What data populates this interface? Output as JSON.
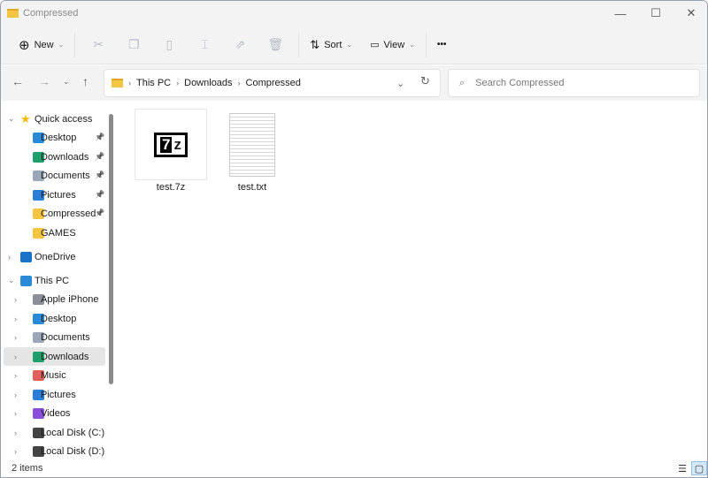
{
  "window": {
    "title": "Compressed"
  },
  "toolbar": {
    "new": "New",
    "sort": "Sort",
    "view": "View",
    "more": "•••"
  },
  "address": {
    "crumbs": [
      "This PC",
      "Downloads",
      "Compressed"
    ],
    "search_placeholder": "Search Compressed"
  },
  "sidebar": {
    "items": [
      {
        "label": "Quick access",
        "icon": "star-icon",
        "color": "#f5b800",
        "level": 0,
        "exp": "v",
        "pin": false
      },
      {
        "label": "Desktop",
        "icon": "desktop-icon",
        "color": "#2b8ad8",
        "level": 1,
        "exp": "",
        "pin": true
      },
      {
        "label": "Downloads",
        "icon": "download-icon",
        "color": "#1e9e6a",
        "level": 1,
        "exp": "",
        "pin": true
      },
      {
        "label": "Documents",
        "icon": "documents-icon",
        "color": "#9aa7b8",
        "level": 1,
        "exp": "",
        "pin": true
      },
      {
        "label": "Pictures",
        "icon": "pictures-icon",
        "color": "#2a7ed8",
        "level": 1,
        "exp": "",
        "pin": true
      },
      {
        "label": "Compressed",
        "icon": "folder-icon",
        "color": "#f4c542",
        "level": 1,
        "exp": "",
        "pin": true
      },
      {
        "label": "GAMES",
        "icon": "folder-icon",
        "color": "#f4c542",
        "level": 1,
        "exp": "",
        "pin": false
      },
      {
        "label": "OneDrive",
        "icon": "cloud-icon",
        "color": "#1a73c8",
        "level": 0,
        "exp": ">",
        "pin": false
      },
      {
        "label": "This PC",
        "icon": "computer-icon",
        "color": "#2b8ad8",
        "level": 0,
        "exp": "v",
        "pin": false
      },
      {
        "label": "Apple iPhone",
        "icon": "phone-icon",
        "color": "#8a8f98",
        "level": 1,
        "exp": ">",
        "pin": false
      },
      {
        "label": "Desktop",
        "icon": "desktop-icon",
        "color": "#2b8ad8",
        "level": 1,
        "exp": ">",
        "pin": false
      },
      {
        "label": "Documents",
        "icon": "documents-icon",
        "color": "#9aa7b8",
        "level": 1,
        "exp": ">",
        "pin": false
      },
      {
        "label": "Downloads",
        "icon": "download-icon",
        "color": "#1e9e6a",
        "level": 1,
        "exp": ">",
        "pin": false,
        "selected": true
      },
      {
        "label": "Music",
        "icon": "music-icon",
        "color": "#e0605a",
        "level": 1,
        "exp": ">",
        "pin": false
      },
      {
        "label": "Pictures",
        "icon": "pictures-icon",
        "color": "#2a7ed8",
        "level": 1,
        "exp": ">",
        "pin": false
      },
      {
        "label": "Videos",
        "icon": "videos-icon",
        "color": "#8a4fd8",
        "level": 1,
        "exp": ">",
        "pin": false
      },
      {
        "label": "Local Disk (C:)",
        "icon": "drive-icon",
        "color": "#444",
        "level": 1,
        "exp": ">",
        "pin": false
      },
      {
        "label": "Local Disk (D:)",
        "icon": "drive-icon",
        "color": "#444",
        "level": 1,
        "exp": ">",
        "pin": false
      }
    ]
  },
  "files": [
    {
      "name": "test.7z",
      "type": "7z"
    },
    {
      "name": "test.txt",
      "type": "txt"
    }
  ],
  "status": {
    "count": "2 items"
  }
}
